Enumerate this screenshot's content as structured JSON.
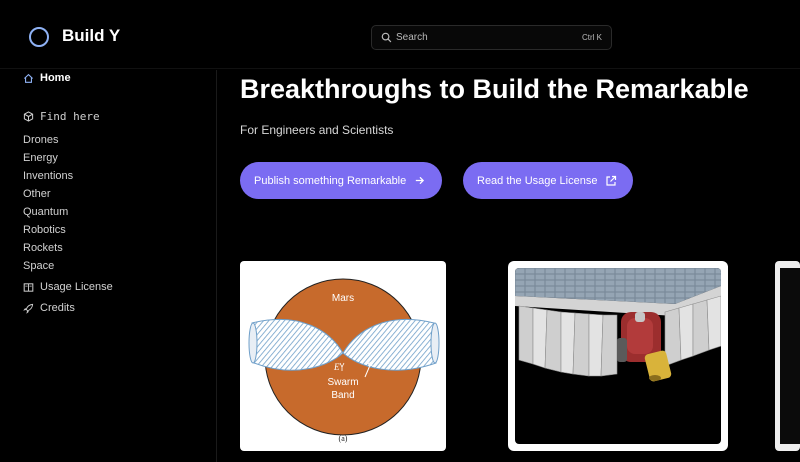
{
  "header": {
    "brand": "Build Y",
    "search_placeholder": "Search",
    "search_shortcut": "Ctrl K"
  },
  "sidebar": {
    "home": "Home",
    "find": "Find here",
    "categories": [
      "Drones",
      "Energy",
      "Inventions",
      "Other",
      "Quantum",
      "Robotics",
      "Rockets",
      "Space"
    ],
    "usage_license": "Usage License",
    "credits": "Credits"
  },
  "main": {
    "title": "Breakthroughs to Build the Remarkable",
    "subtitle": "For Engineers and Scientists",
    "publish_button": "Publish something Remarkable",
    "license_button": "Read the Usage License"
  },
  "cards": {
    "diagram": {
      "top_label": "Mars",
      "symbol_label": "E",
      "band_label_1": "Swarm",
      "band_label_2": "Band",
      "caption": "(a)"
    }
  },
  "colors": {
    "accent": "#7b6cf2",
    "mars": "#c76a2c",
    "logo_ring": "#8fb2f5"
  }
}
